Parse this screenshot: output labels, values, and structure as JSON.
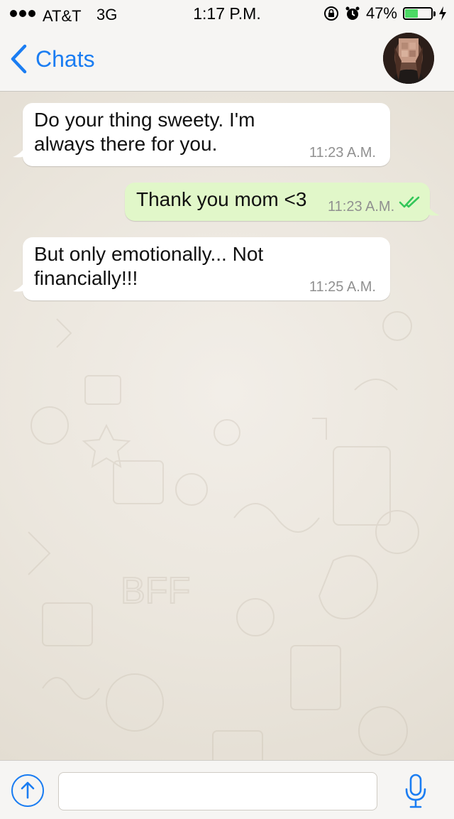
{
  "status_bar": {
    "carrier": "AT&T",
    "network": "3G",
    "time": "1:17 P.M.",
    "battery_percent": "47%",
    "battery_level": 0.47,
    "icons": [
      "orientation-lock-icon",
      "alarm-icon",
      "charging-icon"
    ]
  },
  "nav": {
    "back_label": "Chats",
    "avatar_icon": "contact-avatar"
  },
  "messages": [
    {
      "direction": "incoming",
      "text_lines": [
        "Do your thing sweety. I'm",
        "always there for you."
      ],
      "time": "11:23 A.M."
    },
    {
      "direction": "outgoing",
      "text_lines": [
        "Thank you mom <3"
      ],
      "time": "11:23 A.M.",
      "status": "read"
    },
    {
      "direction": "incoming",
      "text_lines": [
        "But only emotionally... Not",
        "financially!!!"
      ],
      "time": "11:25 A.M."
    }
  ],
  "input": {
    "value": "",
    "placeholder": "",
    "attach_icon": "share-upload-icon",
    "mic_icon": "microphone-icon"
  },
  "colors": {
    "accent": "#1b7df2",
    "outgoing_bubble": "#e1f7c9",
    "incoming_bubble": "#ffffff",
    "read_ticks": "#34c759",
    "battery": "#4cd964"
  }
}
